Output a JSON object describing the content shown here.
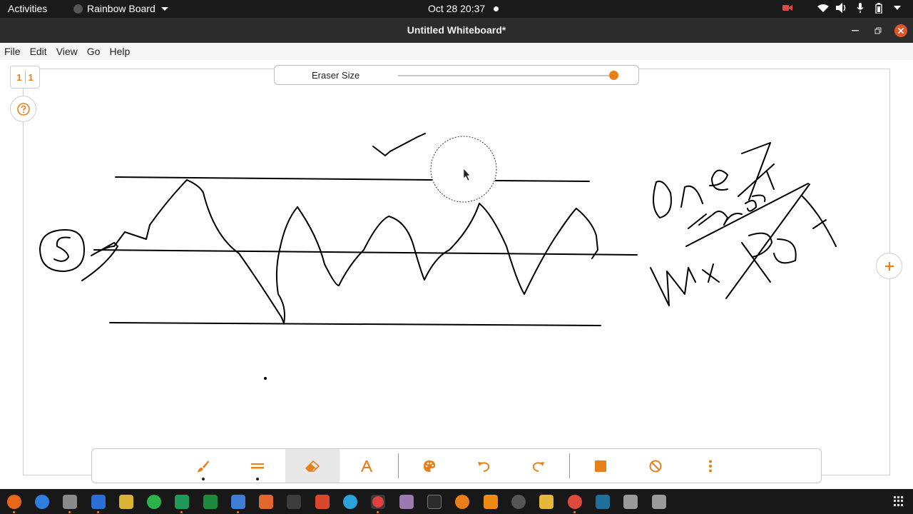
{
  "topbar": {
    "activities": "Activities",
    "app_name": "Rainbow Board",
    "clock": "Oct 28  20:37"
  },
  "window": {
    "title": "Untitled Whiteboard*"
  },
  "menubar": {
    "items": [
      "File",
      "Edit",
      "View",
      "Go",
      "Help"
    ]
  },
  "page_counter": {
    "current": "1",
    "total": "1"
  },
  "eraser_panel": {
    "label": "Eraser Size",
    "value_fraction": 0.98
  },
  "toolbar": {
    "tools": [
      "brush-icon",
      "line-width-icon",
      "eraser-icon",
      "text-icon",
      "palette-icon",
      "undo-icon",
      "redo-icon",
      "fill-color-icon",
      "clear-icon",
      "more-icon"
    ],
    "active_tool": "eraser-icon"
  },
  "colors": {
    "accent": "#e8801a",
    "ink": "#000000",
    "topbar": "#1a1a1a"
  }
}
